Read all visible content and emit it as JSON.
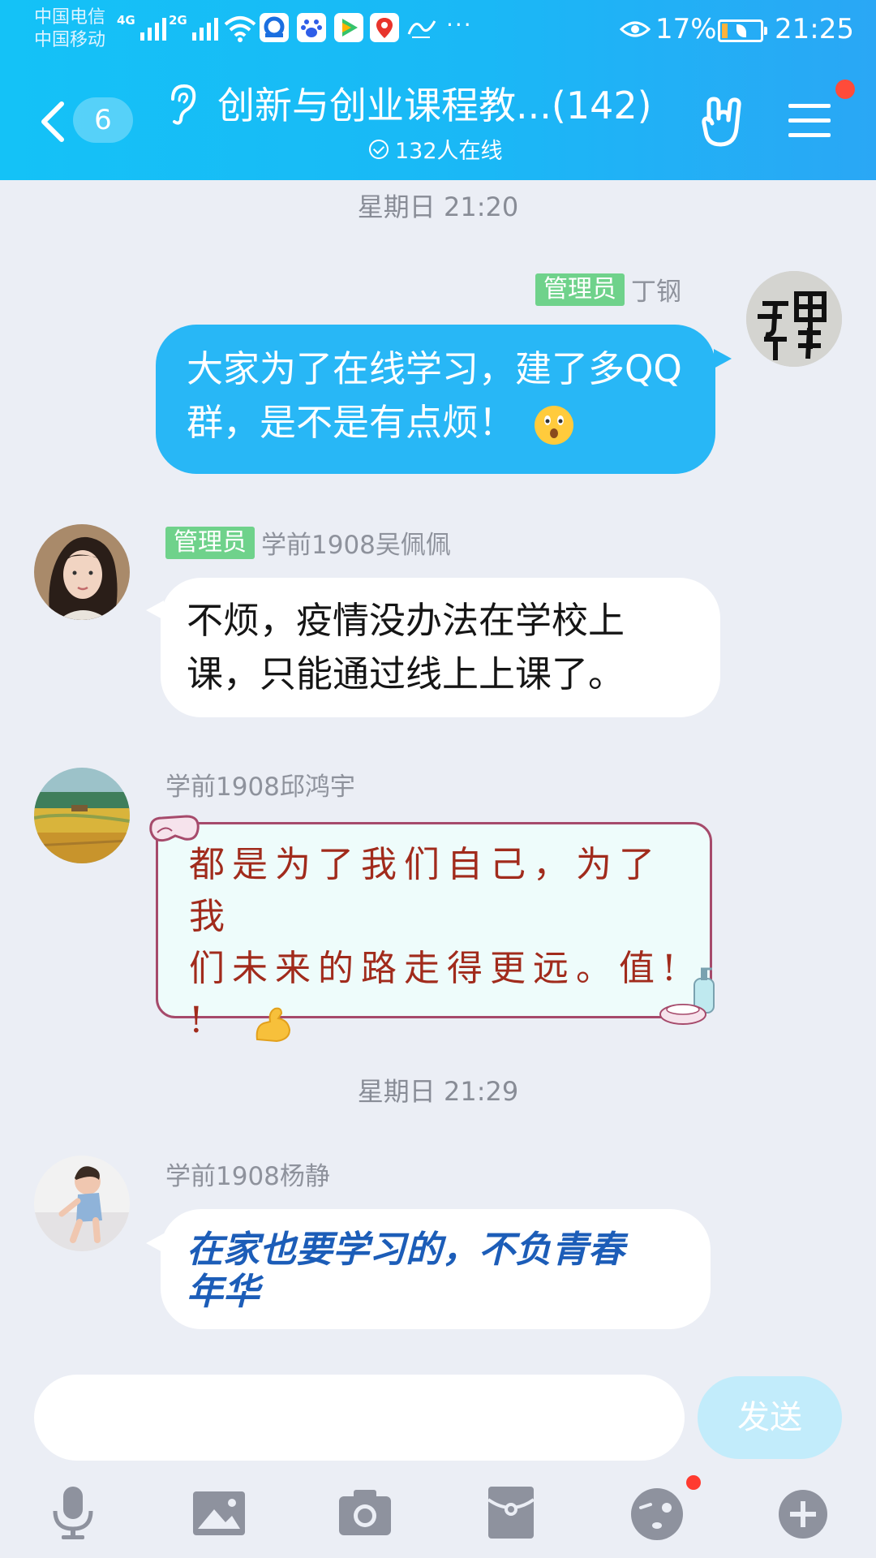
{
  "status_bar": {
    "carrier_1": "中国电信",
    "carrier_2": "中国移动",
    "net_1": "4G",
    "net_2": "2G",
    "app_icons": [
      "wifi-icon",
      "qq-browser-icon",
      "baidu-icon",
      "video-play-icon",
      "baidu-map-icon",
      "xuexi-icon"
    ],
    "more": "···",
    "battery_percent": "17%",
    "battery_level": 0.17,
    "time": "21:25"
  },
  "nav": {
    "unread_count": "6",
    "group_title": "创新与创业课程教...(142)",
    "online_status": "132人在线"
  },
  "messages": [
    {
      "type": "timestamp",
      "text": "星期日 21:20"
    },
    {
      "side": "right",
      "role_tag": "管理员",
      "sender": "丁钢",
      "avatar_text": "丁甲 钢子",
      "text": "大家为了在线学习，建了多QQ群，是不是有点烦！",
      "emoji": "surprised-emoji"
    },
    {
      "side": "left",
      "role_tag": "管理员",
      "sender": "学前1908吴佩佩",
      "line_1": "不烦，疫情没办法在学校上",
      "line_2": "课，只能通过线上上课了。"
    },
    {
      "side": "left",
      "sender": "学前1908邱鸿宇",
      "line_1": "都是为了我们自己，为了我",
      "line_2": "们未来的路走得更远。值!",
      "line_3": "!",
      "emoji": "flexed-biceps-emoji"
    },
    {
      "type": "timestamp",
      "text": "星期日 21:29"
    },
    {
      "side": "left",
      "sender": "学前1908杨静",
      "line_1": "在家也要学习的，不负青春",
      "line_2": "年华"
    }
  ],
  "composer": {
    "input_value": "",
    "send_label": "发送"
  },
  "toolbar": {
    "items": [
      "microphone-icon",
      "image-icon",
      "camera-icon",
      "red-packet-icon",
      "emoji-icon",
      "plus-icon"
    ]
  },
  "colors": {
    "header_gradient_start": "#14c2f7",
    "header_gradient_end": "#2aa7f5",
    "self_bubble": "#28b7f6",
    "admin_tag": "#6fd28b",
    "background": "#ebeef5",
    "notification_dot": "#ff4b3a"
  }
}
